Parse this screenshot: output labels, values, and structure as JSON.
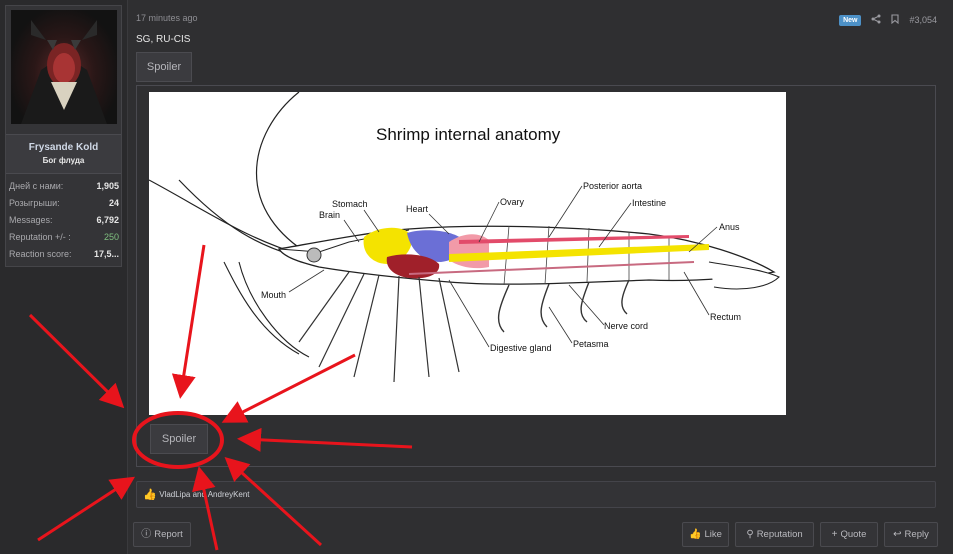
{
  "post": {
    "time": "17 minutes ago",
    "badge": "New",
    "number": "#3,054",
    "subject": "SG, RU-CIS"
  },
  "user": {
    "name": "Frysande Kold",
    "title": "Бог флуда",
    "stats": [
      {
        "label": "Дней с нами:",
        "value": "1,905"
      },
      {
        "label": "Розыгрыши:",
        "value": "24"
      },
      {
        "label": "Messages:",
        "value": "6,792"
      },
      {
        "label": "Reputation +/- :",
        "value": "250"
      },
      {
        "label": "Reaction score:",
        "value": "17,5..."
      }
    ]
  },
  "spoiler": {
    "top_label": "Spoiler",
    "bottom_label": "Spoiler"
  },
  "diagram": {
    "title": "Shrimp internal anatomy",
    "labels": {
      "stomach": "Stomach",
      "brain": "Brain",
      "heart": "Heart",
      "ovary": "Ovary",
      "posterior_aorta": "Posterior aorta",
      "intestine": "Intestine",
      "anus": "Anus",
      "mouth": "Mouth",
      "rectum": "Rectum",
      "nerve_cord": "Nerve cord",
      "digestive_gland": "Digestive gland",
      "petasma": "Petasma"
    }
  },
  "reactions": {
    "text": "VladLipa and AndreyKent"
  },
  "footer": {
    "report": "Report",
    "like": "Like",
    "reputation": "Reputation",
    "quote": "Quote",
    "reply": "Reply"
  },
  "colors": {
    "background": "#2f2f31",
    "badge": "#4d91c7",
    "annotation_red": "#e8141c",
    "reputation_green": "#7fbf7f"
  },
  "icons": [
    "share-icon",
    "bookmark-icon",
    "thumbs-up-icon",
    "report-icon",
    "like-icon",
    "search-icon",
    "plus-icon",
    "reply-icon"
  ]
}
